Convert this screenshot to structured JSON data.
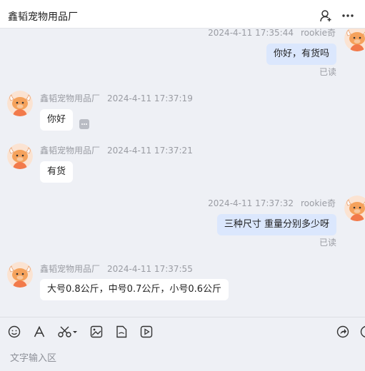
{
  "header": {
    "title": "鑫韬宠物用品厂",
    "icons": [
      "add-contact-icon",
      "more-icon"
    ]
  },
  "messages": [
    {
      "side": "out",
      "sender": "rookie奇",
      "time": "2024-4-11 17:35:44",
      "text": "你好，有货吗",
      "status": "已读"
    },
    {
      "side": "in",
      "sender": "鑫韬宠物用品厂",
      "time": "2024-4-11 17:37:19",
      "text": "你好"
    },
    {
      "side": "in",
      "sender": "鑫韬宠物用品厂",
      "time": "2024-4-11 17:37:21",
      "text": "有货"
    },
    {
      "side": "out",
      "sender": "rookie奇",
      "time": "2024-4-11 17:37:32",
      "text": "三种尺寸 重量分别多少呀",
      "status": "已读"
    },
    {
      "side": "in",
      "sender": "鑫韬宠物用品厂",
      "time": "2024-4-11 17:37:55",
      "text": "大号0.8公斤，中号0.7公斤，小号0.6公斤"
    }
  ],
  "toolbar": {
    "left_icons": [
      "emoji-icon",
      "font-icon",
      "scissors-icon",
      "image-icon",
      "file-icon",
      "video-icon"
    ],
    "right_icons": [
      "share-icon",
      "chat-icon"
    ]
  },
  "input": {
    "placeholder": "文字输入区"
  }
}
